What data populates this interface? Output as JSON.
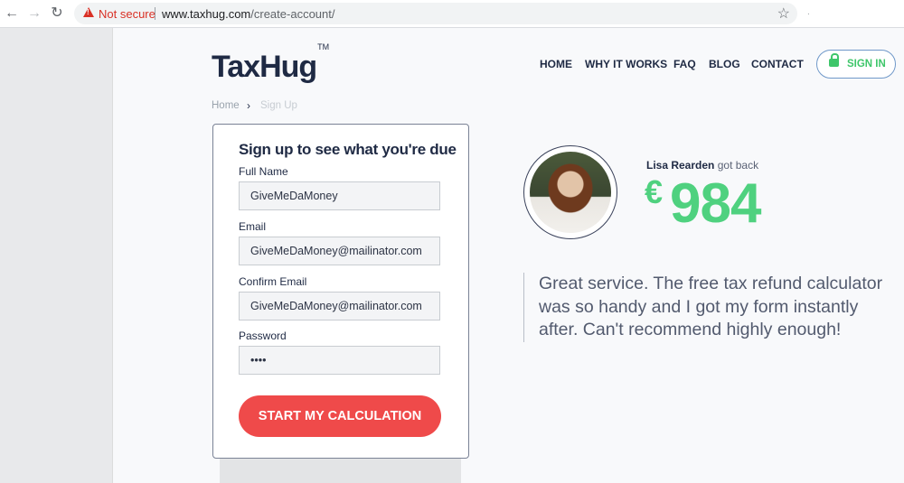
{
  "browser": {
    "security_label": "Not secure",
    "url_host": "www.taxhug.com",
    "url_path": "/create-account/"
  },
  "header": {
    "logo_text": "TaxHug",
    "logo_tm": "TM",
    "nav": [
      "HOME",
      "WHY IT WORKS",
      "FAQ",
      "BLOG",
      "CONTACT"
    ],
    "signin_label": "SIGN IN"
  },
  "breadcrumb": {
    "home": "Home",
    "current": "Sign Up"
  },
  "form": {
    "title": "Sign up to see what you're due",
    "full_name_label": "Full Name",
    "full_name_value": "GiveMeDaMoney",
    "email_label": "Email",
    "email_value": "GiveMeDaMoney@mailinator.com",
    "confirm_email_label": "Confirm Email",
    "confirm_email_value": "GiveMeDaMoney@mailinator.com",
    "password_label": "Password",
    "password_value": "1234",
    "submit_label": "START MY CALCULATION"
  },
  "testimonial": {
    "name": "Lisa Rearden",
    "got_back": "got back",
    "currency": "€",
    "amount": "984",
    "quote": "Great service. The free tax refund calculator was so handy and I got my form instantly after. Can't recommend highly enough!"
  },
  "colors": {
    "brand_navy": "#1f2a44",
    "accent_green": "#4fd17f",
    "cta_red": "#ef4a4a",
    "warning_red": "#d93025"
  }
}
